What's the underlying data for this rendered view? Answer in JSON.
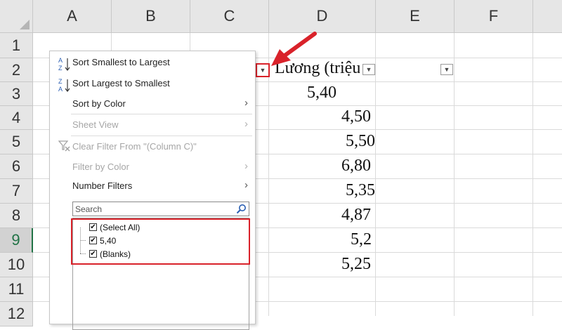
{
  "columns": [
    "A",
    "B",
    "C",
    "D",
    "E",
    "F"
  ],
  "rows": [
    "1",
    "2",
    "3",
    "4",
    "5",
    "6",
    "7",
    "8",
    "9",
    "10",
    "11",
    "12"
  ],
  "selected_row": "9",
  "header_cell": "Lương (triệu",
  "values": [
    "5,40",
    "4,50",
    "5,50",
    "6,80",
    "5,35",
    "4,87",
    "5,2",
    "5,25"
  ],
  "menu": {
    "sort_asc": "Sort Smallest to Largest",
    "sort_desc": "Sort Largest to Smallest",
    "sort_color": "Sort by Color",
    "sheet_view": "Sheet View",
    "clear_filter": "Clear Filter From \"(Column C)\"",
    "filter_color": "Filter by Color",
    "number_filters": "Number Filters",
    "search_placeholder": "Search",
    "items": [
      "(Select All)",
      "5,40",
      "(Blanks)"
    ]
  },
  "colors": {
    "highlight": "#d9222a",
    "excel_green": "#217346"
  },
  "icons": [
    "sort-ascending-icon",
    "sort-descending-icon",
    "clear-filter-icon",
    "search-icon",
    "chevron-right-icon",
    "dropdown-arrow-icon",
    "red-arrow-icon"
  ]
}
